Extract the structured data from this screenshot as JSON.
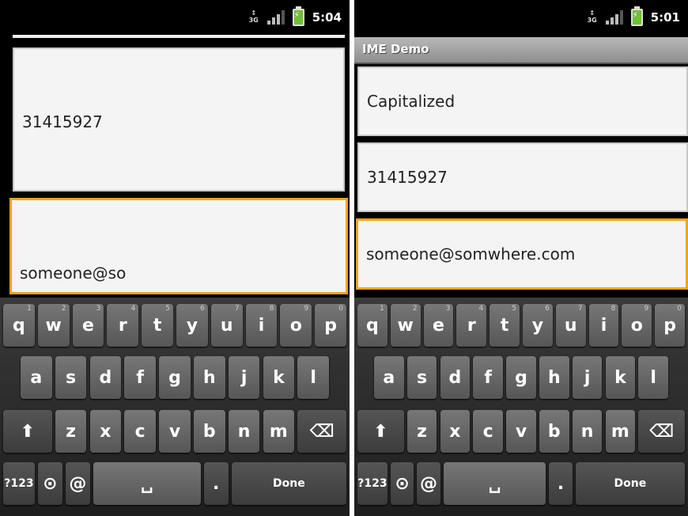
{
  "left": {
    "status": {
      "time": "5:04",
      "network": "3G"
    },
    "fields": {
      "number": "31415927",
      "email": "someone@so"
    }
  },
  "right": {
    "status": {
      "time": "5:01",
      "network": "3G"
    },
    "title": "IME Demo",
    "fields": {
      "capitalized": "Capitalized",
      "number": "31415927",
      "email": "someone@somwhere.com"
    }
  },
  "keyboard": {
    "row1": [
      "q",
      "w",
      "e",
      "r",
      "t",
      "y",
      "u",
      "i",
      "o",
      "p"
    ],
    "row1_hints": [
      "1",
      "2",
      "3",
      "4",
      "5",
      "6",
      "7",
      "8",
      "9",
      "0"
    ],
    "row2": [
      "a",
      "s",
      "d",
      "f",
      "g",
      "h",
      "j",
      "k",
      "l"
    ],
    "row3": [
      "z",
      "x",
      "c",
      "v",
      "b",
      "n",
      "m"
    ],
    "shift": "⬆",
    "delete": "⌫",
    "symbols": "?123",
    "voice": "⊙",
    "at": "@",
    "space": "␣",
    "period": ".",
    "done": "Done"
  },
  "icons": {
    "shift": "shift-icon",
    "delete": "backspace-icon",
    "voice": "microphone-icon",
    "battery": "battery-icon",
    "signal": "signal-icon"
  }
}
